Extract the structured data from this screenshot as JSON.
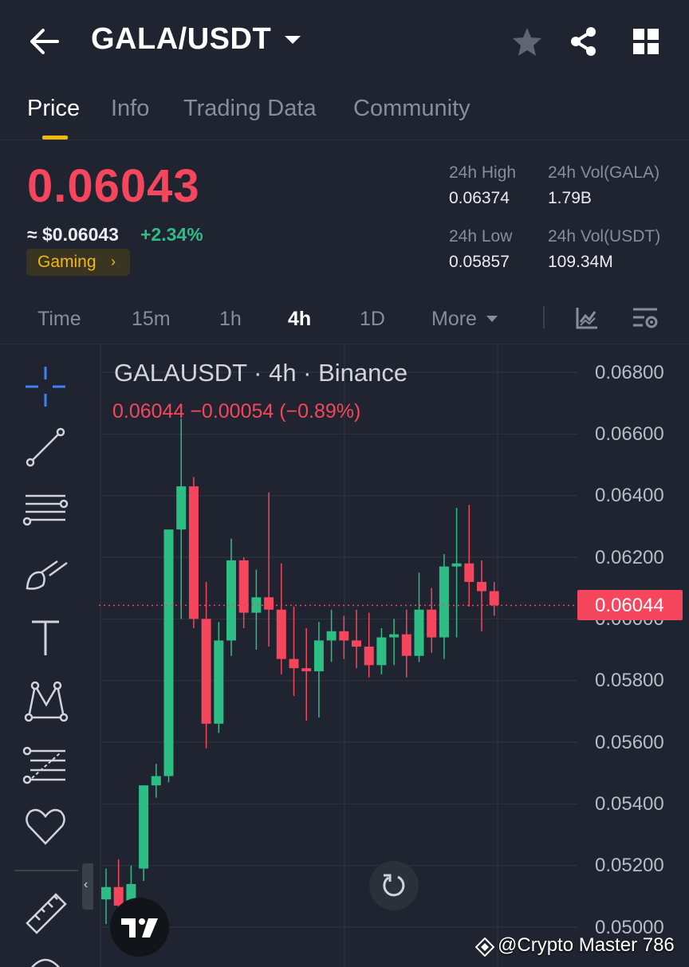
{
  "header": {
    "pair": "GALA/USDT",
    "icons": [
      "back-arrow-icon",
      "caret-down-icon",
      "star-icon",
      "share-icon",
      "grid-icon"
    ]
  },
  "tabs": [
    {
      "label": "Price",
      "active": true
    },
    {
      "label": "Info",
      "active": false
    },
    {
      "label": "Trading Data",
      "active": false
    },
    {
      "label": "Community",
      "active": false
    }
  ],
  "price": {
    "last": "0.06043",
    "fiat": "≈ $0.06043",
    "change": "+2.34%",
    "tag": "Gaming",
    "tag_arrow": "›"
  },
  "stats": {
    "high_label": "24h High",
    "high_value": "0.06374",
    "vol_base_label": "24h Vol(GALA)",
    "vol_base_value": "1.79B",
    "low_label": "24h Low",
    "low_value": "0.05857",
    "vol_quote_label": "24h Vol(USDT)",
    "vol_quote_value": "109.34M"
  },
  "intervals": {
    "items": [
      "Time",
      "15m",
      "1h",
      "4h",
      "1D",
      "More"
    ],
    "active": "4h"
  },
  "chart": {
    "title": "GALAUSDT · 4h · Binance",
    "legend": "0.06044  −0.00054 (−0.89%)",
    "current_price_tag": "0.06044",
    "y_labels": [
      "0.06800",
      "0.06600",
      "0.06400",
      "0.06200",
      "0.06000",
      "0.05800",
      "0.05600",
      "0.05400",
      "0.05200",
      "0.05000"
    ]
  },
  "chart_data": {
    "type": "candlestick",
    "title": "GALAUSDT · 4h · Binance",
    "ylim": [
      0.05,
      0.068
    ],
    "up_color": "#2ebd85",
    "down_color": "#f6465d",
    "last_price": 0.06044,
    "candles": [
      {
        "o": 0.0509,
        "h": 0.0519,
        "l": 0.0501,
        "c": 0.0513
      },
      {
        "o": 0.0513,
        "h": 0.0522,
        "l": 0.0506,
        "c": 0.0507
      },
      {
        "o": 0.0508,
        "h": 0.052,
        "l": 0.0502,
        "c": 0.0514
      },
      {
        "o": 0.0519,
        "h": 0.0546,
        "l": 0.0515,
        "c": 0.0546
      },
      {
        "o": 0.0546,
        "h": 0.0553,
        "l": 0.0542,
        "c": 0.0549
      },
      {
        "o": 0.0549,
        "h": 0.0629,
        "l": 0.0547,
        "c": 0.0629
      },
      {
        "o": 0.0629,
        "h": 0.0665,
        "l": 0.06,
        "c": 0.0643
      },
      {
        "o": 0.0643,
        "h": 0.0646,
        "l": 0.0597,
        "c": 0.06
      },
      {
        "o": 0.06,
        "h": 0.0612,
        "l": 0.0558,
        "c": 0.0566
      },
      {
        "o": 0.0566,
        "h": 0.0599,
        "l": 0.0563,
        "c": 0.0593
      },
      {
        "o": 0.0593,
        "h": 0.0626,
        "l": 0.0588,
        "c": 0.0619
      },
      {
        "o": 0.0619,
        "h": 0.062,
        "l": 0.0597,
        "c": 0.0602
      },
      {
        "o": 0.0602,
        "h": 0.0616,
        "l": 0.059,
        "c": 0.0607
      },
      {
        "o": 0.0607,
        "h": 0.0641,
        "l": 0.0591,
        "c": 0.0603
      },
      {
        "o": 0.0603,
        "h": 0.0618,
        "l": 0.0582,
        "c": 0.0587
      },
      {
        "o": 0.0587,
        "h": 0.0604,
        "l": 0.0575,
        "c": 0.0584
      },
      {
        "o": 0.0584,
        "h": 0.0597,
        "l": 0.0567,
        "c": 0.0583
      },
      {
        "o": 0.0583,
        "h": 0.0599,
        "l": 0.0568,
        "c": 0.0593
      },
      {
        "o": 0.0593,
        "h": 0.0603,
        "l": 0.0586,
        "c": 0.0596
      },
      {
        "o": 0.0596,
        "h": 0.0601,
        "l": 0.0587,
        "c": 0.0593
      },
      {
        "o": 0.0593,
        "h": 0.0603,
        "l": 0.0584,
        "c": 0.0591
      },
      {
        "o": 0.0591,
        "h": 0.0602,
        "l": 0.0581,
        "c": 0.0585
      },
      {
        "o": 0.0585,
        "h": 0.0597,
        "l": 0.0582,
        "c": 0.0594
      },
      {
        "o": 0.0594,
        "h": 0.06,
        "l": 0.0585,
        "c": 0.0595
      },
      {
        "o": 0.0595,
        "h": 0.0603,
        "l": 0.0581,
        "c": 0.0588
      },
      {
        "o": 0.0588,
        "h": 0.0615,
        "l": 0.0586,
        "c": 0.0603
      },
      {
        "o": 0.0603,
        "h": 0.061,
        "l": 0.0589,
        "c": 0.0594
      },
      {
        "o": 0.0594,
        "h": 0.0621,
        "l": 0.0587,
        "c": 0.0617
      },
      {
        "o": 0.0617,
        "h": 0.0636,
        "l": 0.0594,
        "c": 0.0618
      },
      {
        "o": 0.0618,
        "h": 0.0637,
        "l": 0.0604,
        "c": 0.0612
      },
      {
        "o": 0.0612,
        "h": 0.0619,
        "l": 0.0596,
        "c": 0.0609
      },
      {
        "o": 0.0609,
        "h": 0.0612,
        "l": 0.0601,
        "c": 0.06044
      }
    ]
  },
  "toolbar": {
    "tools": [
      "crosshair-icon",
      "trend-line-icon",
      "horizontal-lines-icon",
      "brush-icon",
      "text-icon",
      "pattern-icon",
      "fib-icon",
      "favorite-icon",
      "ruler-icon"
    ],
    "collapse_glyph": "‹"
  },
  "watermark": "@Crypto Master 786"
}
